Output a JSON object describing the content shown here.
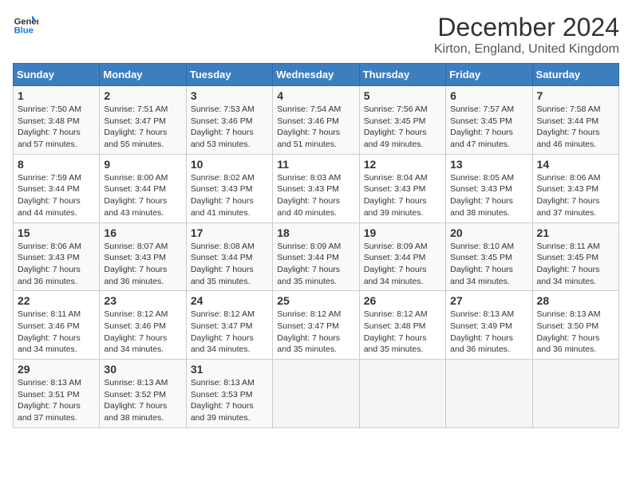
{
  "logo": {
    "line1": "General",
    "line2": "Blue"
  },
  "title": "December 2024",
  "location": "Kirton, England, United Kingdom",
  "days_of_week": [
    "Sunday",
    "Monday",
    "Tuesday",
    "Wednesday",
    "Thursday",
    "Friday",
    "Saturday"
  ],
  "weeks": [
    [
      {
        "day": "1",
        "sunrise": "7:50 AM",
        "sunset": "3:48 PM",
        "daylight_h": "7",
        "daylight_m": "57"
      },
      {
        "day": "2",
        "sunrise": "7:51 AM",
        "sunset": "3:47 PM",
        "daylight_h": "7",
        "daylight_m": "55"
      },
      {
        "day": "3",
        "sunrise": "7:53 AM",
        "sunset": "3:46 PM",
        "daylight_h": "7",
        "daylight_m": "53"
      },
      {
        "day": "4",
        "sunrise": "7:54 AM",
        "sunset": "3:46 PM",
        "daylight_h": "7",
        "daylight_m": "51"
      },
      {
        "day": "5",
        "sunrise": "7:56 AM",
        "sunset": "3:45 PM",
        "daylight_h": "7",
        "daylight_m": "49"
      },
      {
        "day": "6",
        "sunrise": "7:57 AM",
        "sunset": "3:45 PM",
        "daylight_h": "7",
        "daylight_m": "47"
      },
      {
        "day": "7",
        "sunrise": "7:58 AM",
        "sunset": "3:44 PM",
        "daylight_h": "7",
        "daylight_m": "46"
      }
    ],
    [
      {
        "day": "8",
        "sunrise": "7:59 AM",
        "sunset": "3:44 PM",
        "daylight_h": "7",
        "daylight_m": "44"
      },
      {
        "day": "9",
        "sunrise": "8:00 AM",
        "sunset": "3:44 PM",
        "daylight_h": "7",
        "daylight_m": "43"
      },
      {
        "day": "10",
        "sunrise": "8:02 AM",
        "sunset": "3:43 PM",
        "daylight_h": "7",
        "daylight_m": "41"
      },
      {
        "day": "11",
        "sunrise": "8:03 AM",
        "sunset": "3:43 PM",
        "daylight_h": "7",
        "daylight_m": "40"
      },
      {
        "day": "12",
        "sunrise": "8:04 AM",
        "sunset": "3:43 PM",
        "daylight_h": "7",
        "daylight_m": "39"
      },
      {
        "day": "13",
        "sunrise": "8:05 AM",
        "sunset": "3:43 PM",
        "daylight_h": "7",
        "daylight_m": "38"
      },
      {
        "day": "14",
        "sunrise": "8:06 AM",
        "sunset": "3:43 PM",
        "daylight_h": "7",
        "daylight_m": "37"
      }
    ],
    [
      {
        "day": "15",
        "sunrise": "8:06 AM",
        "sunset": "3:43 PM",
        "daylight_h": "7",
        "daylight_m": "36"
      },
      {
        "day": "16",
        "sunrise": "8:07 AM",
        "sunset": "3:43 PM",
        "daylight_h": "7",
        "daylight_m": "36"
      },
      {
        "day": "17",
        "sunrise": "8:08 AM",
        "sunset": "3:44 PM",
        "daylight_h": "7",
        "daylight_m": "35"
      },
      {
        "day": "18",
        "sunrise": "8:09 AM",
        "sunset": "3:44 PM",
        "daylight_h": "7",
        "daylight_m": "35"
      },
      {
        "day": "19",
        "sunrise": "8:09 AM",
        "sunset": "3:44 PM",
        "daylight_h": "7",
        "daylight_m": "34"
      },
      {
        "day": "20",
        "sunrise": "8:10 AM",
        "sunset": "3:45 PM",
        "daylight_h": "7",
        "daylight_m": "34"
      },
      {
        "day": "21",
        "sunrise": "8:11 AM",
        "sunset": "3:45 PM",
        "daylight_h": "7",
        "daylight_m": "34"
      }
    ],
    [
      {
        "day": "22",
        "sunrise": "8:11 AM",
        "sunset": "3:46 PM",
        "daylight_h": "7",
        "daylight_m": "34"
      },
      {
        "day": "23",
        "sunrise": "8:12 AM",
        "sunset": "3:46 PM",
        "daylight_h": "7",
        "daylight_m": "34"
      },
      {
        "day": "24",
        "sunrise": "8:12 AM",
        "sunset": "3:47 PM",
        "daylight_h": "7",
        "daylight_m": "34"
      },
      {
        "day": "25",
        "sunrise": "8:12 AM",
        "sunset": "3:47 PM",
        "daylight_h": "7",
        "daylight_m": "35"
      },
      {
        "day": "26",
        "sunrise": "8:12 AM",
        "sunset": "3:48 PM",
        "daylight_h": "7",
        "daylight_m": "35"
      },
      {
        "day": "27",
        "sunrise": "8:13 AM",
        "sunset": "3:49 PM",
        "daylight_h": "7",
        "daylight_m": "36"
      },
      {
        "day": "28",
        "sunrise": "8:13 AM",
        "sunset": "3:50 PM",
        "daylight_h": "7",
        "daylight_m": "36"
      }
    ],
    [
      {
        "day": "29",
        "sunrise": "8:13 AM",
        "sunset": "3:51 PM",
        "daylight_h": "7",
        "daylight_m": "37"
      },
      {
        "day": "30",
        "sunrise": "8:13 AM",
        "sunset": "3:52 PM",
        "daylight_h": "7",
        "daylight_m": "38"
      },
      {
        "day": "31",
        "sunrise": "8:13 AM",
        "sunset": "3:53 PM",
        "daylight_h": "7",
        "daylight_m": "39"
      },
      null,
      null,
      null,
      null
    ]
  ]
}
